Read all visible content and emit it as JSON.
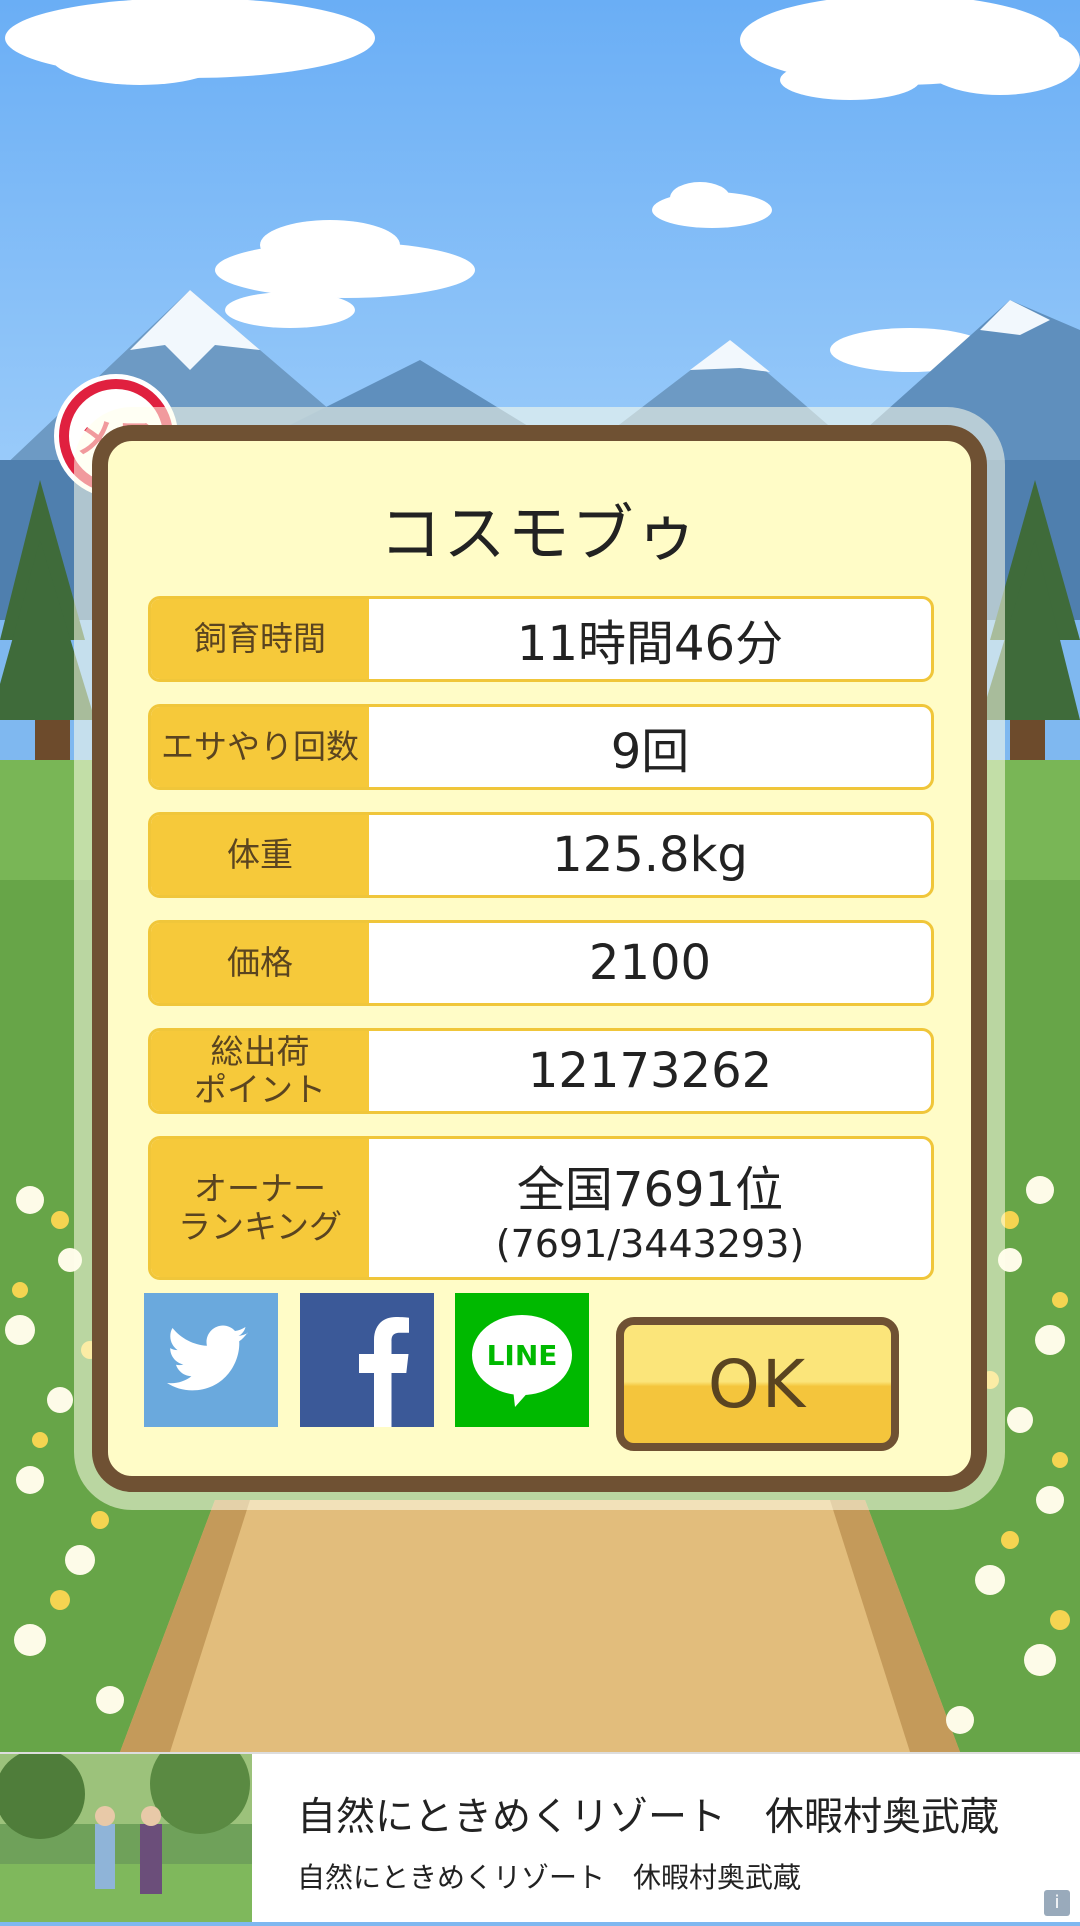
{
  "pet": {
    "name": "コスモブゥ",
    "gender_badge": "メス"
  },
  "stats": [
    {
      "label": "飼育時間",
      "value": "11時間46分"
    },
    {
      "label": "エサやり回数",
      "value": "9回"
    },
    {
      "label": "体重",
      "value": "125.8kg"
    },
    {
      "label": "価格",
      "value": "2100"
    },
    {
      "label": "総出荷\nポイント",
      "value": "12173262"
    },
    {
      "label": "オーナー\nランキング",
      "value": "全国7691位",
      "sub": "(7691/3443293)"
    }
  ],
  "buttons": {
    "ok_label": "OK",
    "line_label": "LINE"
  },
  "ad": {
    "headline": "自然にときめくリゾート　休暇村奥武蔵",
    "description": "自然にときめくリゾート　休暇村奥武蔵",
    "info_icon": "i"
  },
  "colors": {
    "twitter": "#6aa9dd",
    "facebook": "#3b5998",
    "line": "#00b900",
    "panel_border": "#6f5133",
    "label_bg": "#f6c93a",
    "badge": "#e0203f"
  }
}
